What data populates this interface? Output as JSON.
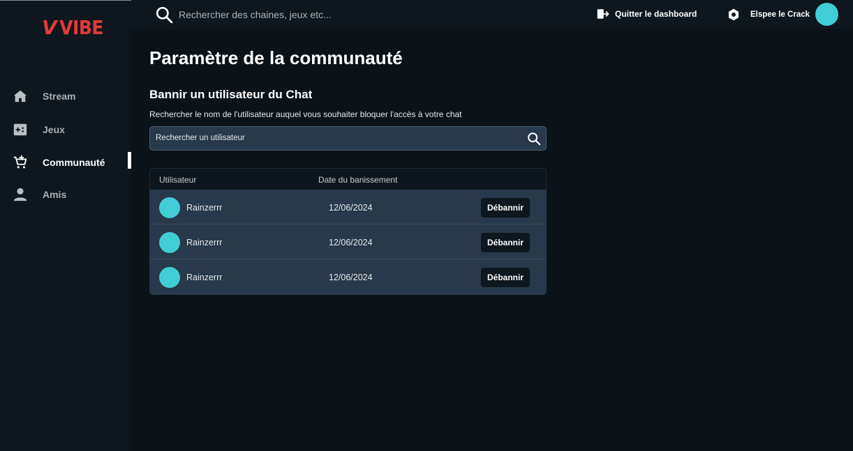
{
  "app": {
    "logo_v": "V",
    "logo_text": "VIBE"
  },
  "colors": {
    "accent": "#41cdd6",
    "brand": "#e23a3a",
    "background": "#0b1218",
    "panel": "#27394a"
  },
  "sidebar": {
    "items": [
      {
        "label": "Stream",
        "icon": "home-icon",
        "active": false
      },
      {
        "label": "Jeux",
        "icon": "gamepad-icon",
        "active": false
      },
      {
        "label": "Communauté",
        "icon": "cart-add-icon",
        "active": true
      },
      {
        "label": "Amis",
        "icon": "person-icon",
        "active": false
      }
    ]
  },
  "header": {
    "search_placeholder": "Rechercher des chaines, jeux etc...",
    "quit_label": "Quitter le dashboard",
    "username": "Elspee le Crack"
  },
  "main": {
    "title": "Paramètre de la communauté",
    "section_title": "Bannir un utilisateur du Chat",
    "section_desc": "Rechercher le nom de l'utilisateur auquel vous souhaiter bloquer l'accès à votre chat",
    "search_placeholder": "Rechercher un utilisateur",
    "table": {
      "columns": [
        "Utilisateur",
        "Date du banissement"
      ],
      "rows": [
        {
          "user": "Rainzerrr",
          "date": "12/06/2024",
          "action": "Débannir"
        },
        {
          "user": "Rainzerrr",
          "date": "12/06/2024",
          "action": "Débannir"
        },
        {
          "user": "Rainzerrr",
          "date": "12/06/2024",
          "action": "Débannir"
        }
      ]
    }
  }
}
